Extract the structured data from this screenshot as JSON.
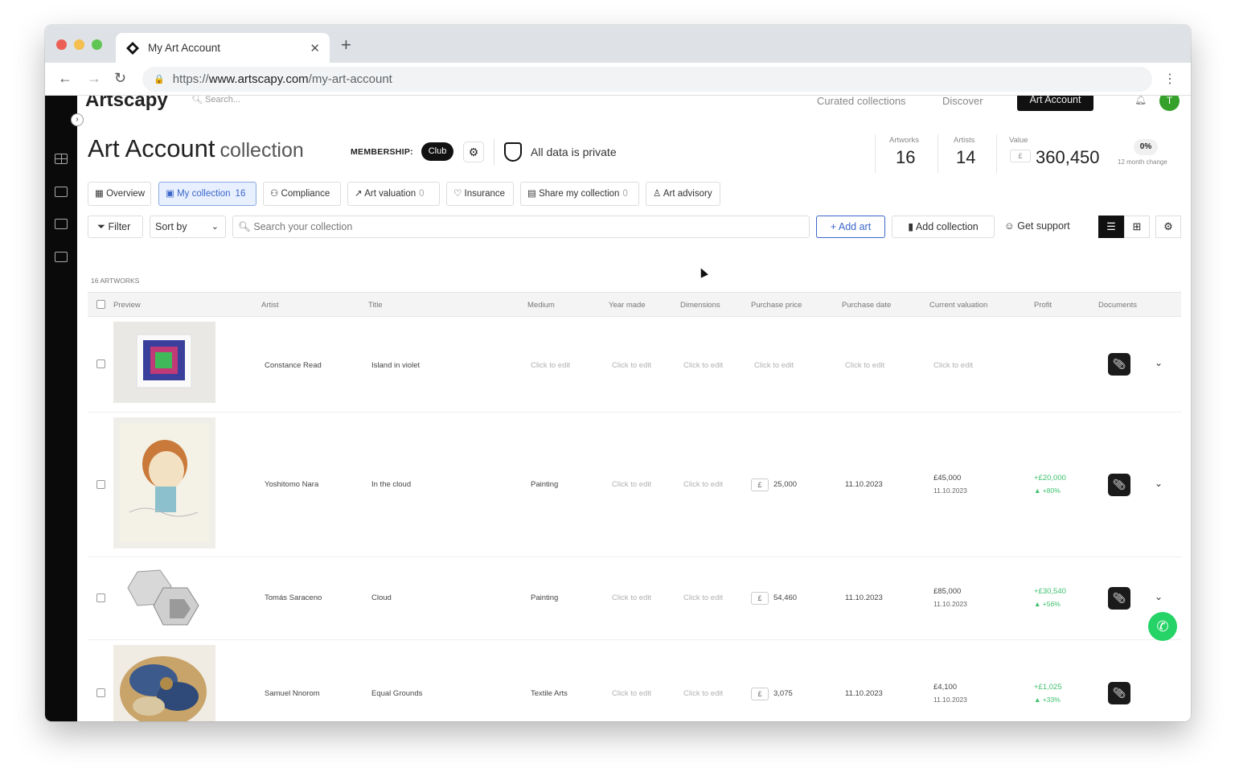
{
  "browser": {
    "tab_title": "My Art Account",
    "url_scheme": "https://",
    "url_host": "www.artscapy.com",
    "url_path": "/my-art-account"
  },
  "app": {
    "logo": "Artscapy",
    "search_placeholder": "Search...",
    "nav": {
      "curated": "Curated collections",
      "discover": "Discover",
      "art_account": "Art Account"
    },
    "avatar_initial": "T"
  },
  "header": {
    "title": "Art Account",
    "subtitle": "collection",
    "membership_label": "MEMBERSHIP:",
    "membership_value": "Club",
    "privacy_text": "All data is private"
  },
  "stats": {
    "artworks_label": "Artworks",
    "artworks_value": "16",
    "artists_label": "Artists",
    "artists_value": "14",
    "value_label": "Value",
    "currency": "£",
    "value_value": "360,450",
    "change_pct": "0%",
    "change_label": "12 month change"
  },
  "tabs": [
    {
      "label": "Overview",
      "count": ""
    },
    {
      "label": "My collection",
      "count": "16"
    },
    {
      "label": "Compliance",
      "count": ""
    },
    {
      "label": "Art valuation",
      "count": "0"
    },
    {
      "label": "Insurance",
      "count": ""
    },
    {
      "label": "Share my collection",
      "count": "0"
    },
    {
      "label": "Art advisory",
      "count": ""
    }
  ],
  "toolbar": {
    "filter": "Filter",
    "sort": "Sort by",
    "search_placeholder": "Search your collection",
    "add_art": "Add art",
    "add_collection": "Add collection",
    "get_support": "Get support"
  },
  "artwork_count": "16 ARTWORKS",
  "columns": [
    "Preview",
    "Artist",
    "Title",
    "Medium",
    "Year made",
    "Dimensions",
    "Purchase price",
    "Purchase date",
    "Current valuation",
    "Profit",
    "Documents"
  ],
  "rows": [
    {
      "artist": "Constance Read",
      "title": "Island in violet",
      "medium": "Click to edit",
      "year": "Click to edit",
      "dimensions": "Click to edit",
      "price": "Click to edit",
      "date": "Click to edit",
      "valuation": "Click to edit",
      "valuation_date": "",
      "profit": "",
      "profit_pct": ""
    },
    {
      "artist": "Yoshitomo Nara",
      "title": "In the cloud",
      "medium": "Painting",
      "year": "Click to edit",
      "dimensions": "Click to edit",
      "price": "25,000",
      "date": "11.10.2023",
      "valuation": "£45,000",
      "valuation_date": "11.10.2023",
      "profit": "+£20,000",
      "profit_pct": "▲ +80%"
    },
    {
      "artist": "Tomás Saraceno",
      "title": "Cloud",
      "medium": "Painting",
      "year": "Click to edit",
      "dimensions": "Click to edit",
      "price": "54,460",
      "date": "11.10.2023",
      "valuation": "£85,000",
      "valuation_date": "11.10.2023",
      "profit": "+£30,540",
      "profit_pct": "▲ +56%"
    },
    {
      "artist": "Samuel Nnorom",
      "title": "Equal Grounds",
      "medium": "Textile Arts",
      "year": "Click to edit",
      "dimensions": "Click to edit",
      "price": "3,075",
      "date": "11.10.2023",
      "valuation": "£4,100",
      "valuation_date": "11.10.2023",
      "profit": "+£1,025",
      "profit_pct": "▲ +33%"
    }
  ],
  "colors": {
    "accent": "#3b66c9",
    "profit": "#3cc06c",
    "dark": "#111111",
    "whatsapp": "#25d366"
  }
}
